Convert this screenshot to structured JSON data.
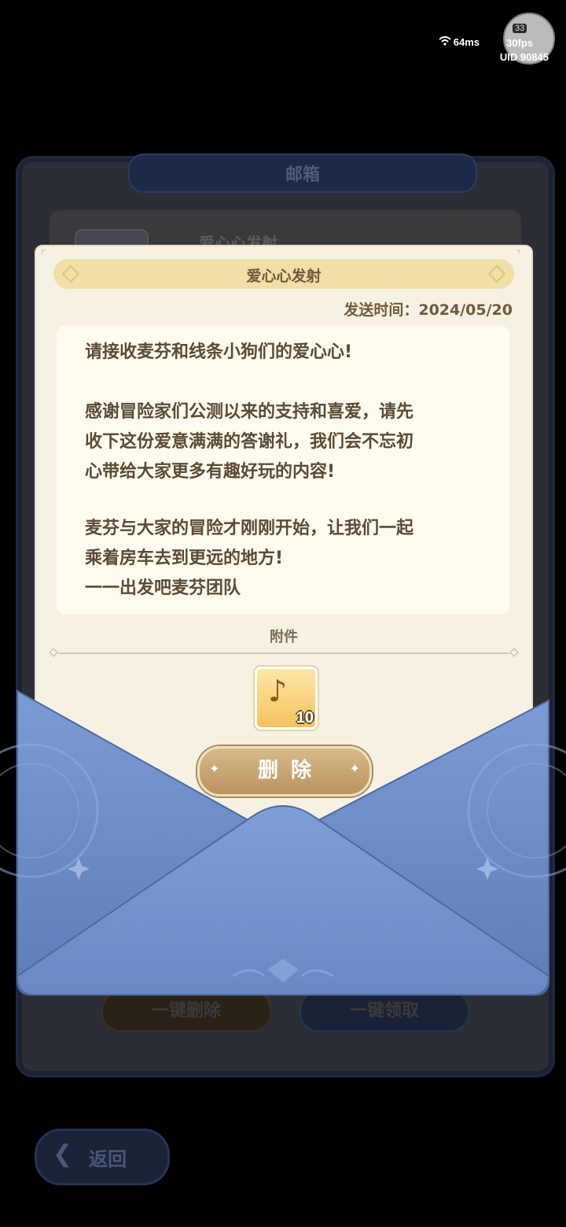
{
  "hud": {
    "ping": "64ms",
    "fps": "30fps",
    "uid": "UID 90845",
    "level": "33"
  },
  "mailbox": {
    "title": "邮箱",
    "mail_item_label": "爱心心发射",
    "delete_all_label": "一键删除",
    "claim_all_label": "一键领取",
    "back_label": "返回"
  },
  "letter": {
    "title": "爱心心发射",
    "send_time": "发送时间：2024/05/20",
    "body_1": "请接收麦芬和线条小狗们的爱心心!",
    "body_2": "感谢冒险家们公测以来的支持和喜爱，请先\n收下这份爱意满满的答谢礼，我们会不忘初\n心带给大家更多有趣好玩的内容!",
    "body_3": "麦芬与大家的冒险才刚刚开始，让我们一起\n乘着房车去到更远的地方!\n一一出发吧麦芬团队",
    "attachment_title": "附件",
    "attachment_qty": "10",
    "delete_label": "删除"
  },
  "colors": {
    "letter_bg": "#f6f1e3",
    "title_bar": "#f0dfa6",
    "text_brown": "#5c4a33",
    "envelope_blue": "#6f8fc9",
    "envelope_dark": "#5a76ad"
  }
}
